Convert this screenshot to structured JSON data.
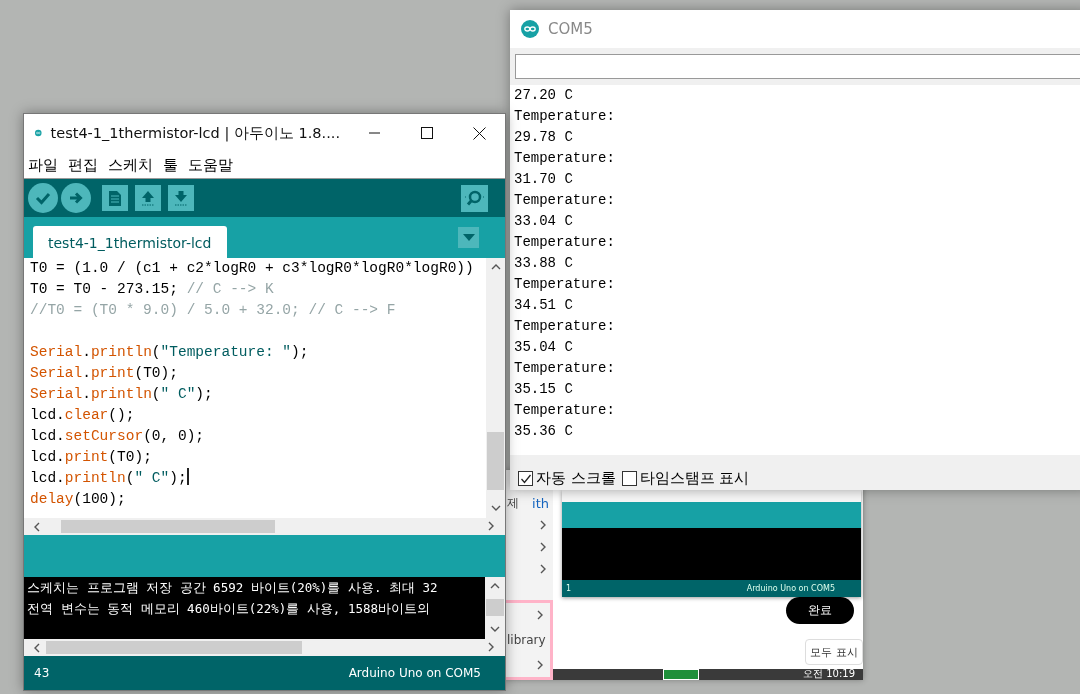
{
  "arduino_window": {
    "title": "test4-1_1thermistor-lcd | 아두이노 1.8....",
    "menu": [
      "파일",
      "편집",
      "스케치",
      "툴",
      "도움말"
    ],
    "tabs": [
      {
        "label": "test4-1_1thermistor-lcd",
        "selected": true
      }
    ],
    "code_lines": [
      {
        "kind": "code",
        "segments": [
          {
            "kind": "plain",
            "text": "T0 = (1.0 / (c1 + c2*logR0 + c3*logR0*logR0*logR0))"
          }
        ]
      },
      {
        "kind": "code",
        "segments": [
          {
            "kind": "plain",
            "text": "T0 = T0 - 273.15; "
          },
          {
            "kind": "comment",
            "text": "// C --> K"
          }
        ]
      },
      {
        "kind": "code",
        "segments": [
          {
            "kind": "comment",
            "text": "//T0 = (T0 * 9.0) / 5.0 + 32.0; // C --> F"
          }
        ]
      },
      {
        "kind": "blank"
      },
      {
        "kind": "code",
        "segments": [
          {
            "kind": "keyword",
            "text": "Serial"
          },
          {
            "kind": "plain",
            "text": "."
          },
          {
            "kind": "keyword",
            "text": "println"
          },
          {
            "kind": "plain",
            "text": "("
          },
          {
            "kind": "string",
            "text": "\"Temperature: \""
          },
          {
            "kind": "plain",
            "text": ");"
          }
        ]
      },
      {
        "kind": "code",
        "segments": [
          {
            "kind": "keyword",
            "text": "Serial"
          },
          {
            "kind": "plain",
            "text": "."
          },
          {
            "kind": "keyword",
            "text": "print"
          },
          {
            "kind": "plain",
            "text": "(T0);"
          }
        ]
      },
      {
        "kind": "code",
        "segments": [
          {
            "kind": "keyword",
            "text": "Serial"
          },
          {
            "kind": "plain",
            "text": "."
          },
          {
            "kind": "keyword",
            "text": "println"
          },
          {
            "kind": "plain",
            "text": "("
          },
          {
            "kind": "string",
            "text": "\" C\""
          },
          {
            "kind": "plain",
            "text": ");"
          }
        ]
      },
      {
        "kind": "code",
        "segments": [
          {
            "kind": "plain",
            "text": "lcd."
          },
          {
            "kind": "keyword",
            "text": "clear"
          },
          {
            "kind": "plain",
            "text": "();"
          }
        ]
      },
      {
        "kind": "code",
        "segments": [
          {
            "kind": "plain",
            "text": "lcd."
          },
          {
            "kind": "keyword",
            "text": "setCursor"
          },
          {
            "kind": "plain",
            "text": "(0, 0);"
          }
        ]
      },
      {
        "kind": "code",
        "segments": [
          {
            "kind": "plain",
            "text": "lcd."
          },
          {
            "kind": "keyword",
            "text": "print"
          },
          {
            "kind": "plain",
            "text": "(T0);"
          }
        ]
      },
      {
        "kind": "code",
        "caret": true,
        "segments": [
          {
            "kind": "plain",
            "text": "lcd."
          },
          {
            "kind": "keyword",
            "text": "println"
          },
          {
            "kind": "plain",
            "text": "("
          },
          {
            "kind": "string",
            "text": "\" C\""
          },
          {
            "kind": "plain",
            "text": ");"
          }
        ]
      },
      {
        "kind": "code",
        "segments": [
          {
            "kind": "keyword",
            "text": "delay"
          },
          {
            "kind": "plain",
            "text": "(100);"
          }
        ]
      }
    ],
    "console_lines": [
      "스케치는 프로그램 저장 공간 6592 바이트(20%)를 사용. 최대 32",
      "전역 변수는 동적 메모리 460바이트(22%)를 사용, 1588바이트의"
    ],
    "status_line": "43",
    "status_board": "Arduino Uno on COM5"
  },
  "serial_monitor": {
    "title": "COM5",
    "output": [
      "27.20 C",
      "Temperature:",
      "29.78 C",
      "Temperature:",
      "31.70 C",
      "Temperature:",
      "33.04 C",
      "Temperature:",
      "33.88 C",
      "Temperature:",
      "34.51 C",
      "Temperature:",
      "35.04 C",
      "Temperature:",
      "35.15 C",
      "Temperature:",
      "35.36 C"
    ],
    "options": [
      {
        "label": "자동 스크롤",
        "checked": true
      },
      {
        "label": "타임스탬프 표시",
        "checked": false
      }
    ]
  },
  "background_page": {
    "sidebar_text": "제",
    "link_text": "ith",
    "library_text": "library",
    "screenshot_status_line": "1",
    "screenshot_status_board": "Arduino Uno on COM5",
    "done_button": "완료",
    "show_all_button": "모두 표시",
    "clock": "오전 10:19"
  }
}
